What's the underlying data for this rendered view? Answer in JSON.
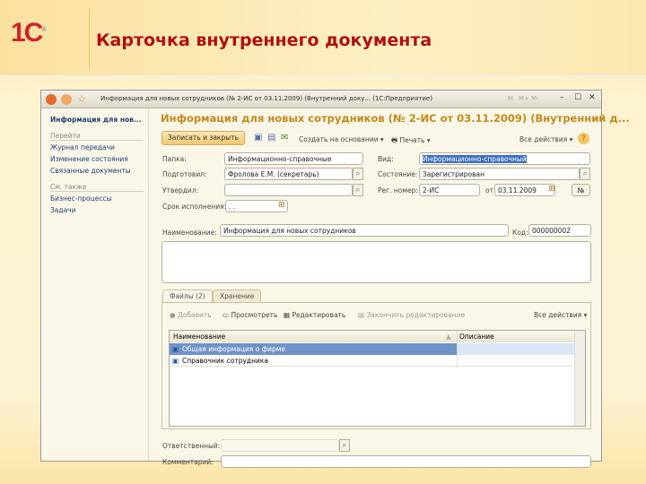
{
  "slide": {
    "logo": "1С",
    "title": "Карточка внутреннего документа"
  },
  "window": {
    "title": "Информация для новых сотрудников (№ 2-ИС от 03.11.2009) (Внутренний доку... (1С:Предприятие)",
    "controls": [
      "M",
      "M+",
      "M-"
    ]
  },
  "nav": {
    "header": "Информация для нов...",
    "section1": "Перейти",
    "items1": [
      "Журнал передачи",
      "Изменение состояния",
      "Связанные документы"
    ],
    "section2": "См. также",
    "items2": [
      "Бизнес-процессы",
      "Задачи"
    ]
  },
  "form": {
    "heading": "Информация для новых сотрудников (№ 2-ИС от 03.11.2009) (Внутренний д...",
    "toolbar": {
      "save_close": "Записать и закрыть",
      "create_based": "Создать на основании ▾",
      "print": "Печать ▾",
      "all_actions": "Все действия ▾",
      "help": "?"
    },
    "folder_label": "Папка:",
    "folder": "Информационно-справочные",
    "prepared_label": "Подготовил:",
    "prepared": "Фролова Е.М. (секретарь)",
    "approved_label": "Утвердил:",
    "approved": "",
    "deadline_label": "Срок исполнения:",
    "deadline": " .  .",
    "kind_label": "Вид:",
    "kind": "Информационно-справочный",
    "state_label": "Состояние:",
    "state": "Зарегистрирован",
    "regnum_label": "Рег. номер:",
    "regnum": "2-ИС",
    "from_label": "от",
    "date": "03.11.2009",
    "num_button": "№",
    "name_label": "Наименование:",
    "name": "Информация для новых сотрудников",
    "code_label": "Код:",
    "code": "000000002",
    "tabs": [
      "Файлы (2)",
      "Хранение"
    ],
    "files_toolbar": {
      "add": "Добавить",
      "view": "Просмотреть",
      "edit": "Редактировать",
      "finish": "Закончить редактирование",
      "all_actions": "Все действия ▾"
    },
    "columns": [
      "Наименование",
      "Описание"
    ],
    "files": [
      {
        "name": "Общая информация о фирме",
        "desc": ""
      },
      {
        "name": "Справочник сотрудника",
        "desc": ""
      }
    ],
    "responsible_label": "Ответственный:",
    "responsible": "",
    "comment_label": "Комментарий:",
    "comment": ""
  }
}
